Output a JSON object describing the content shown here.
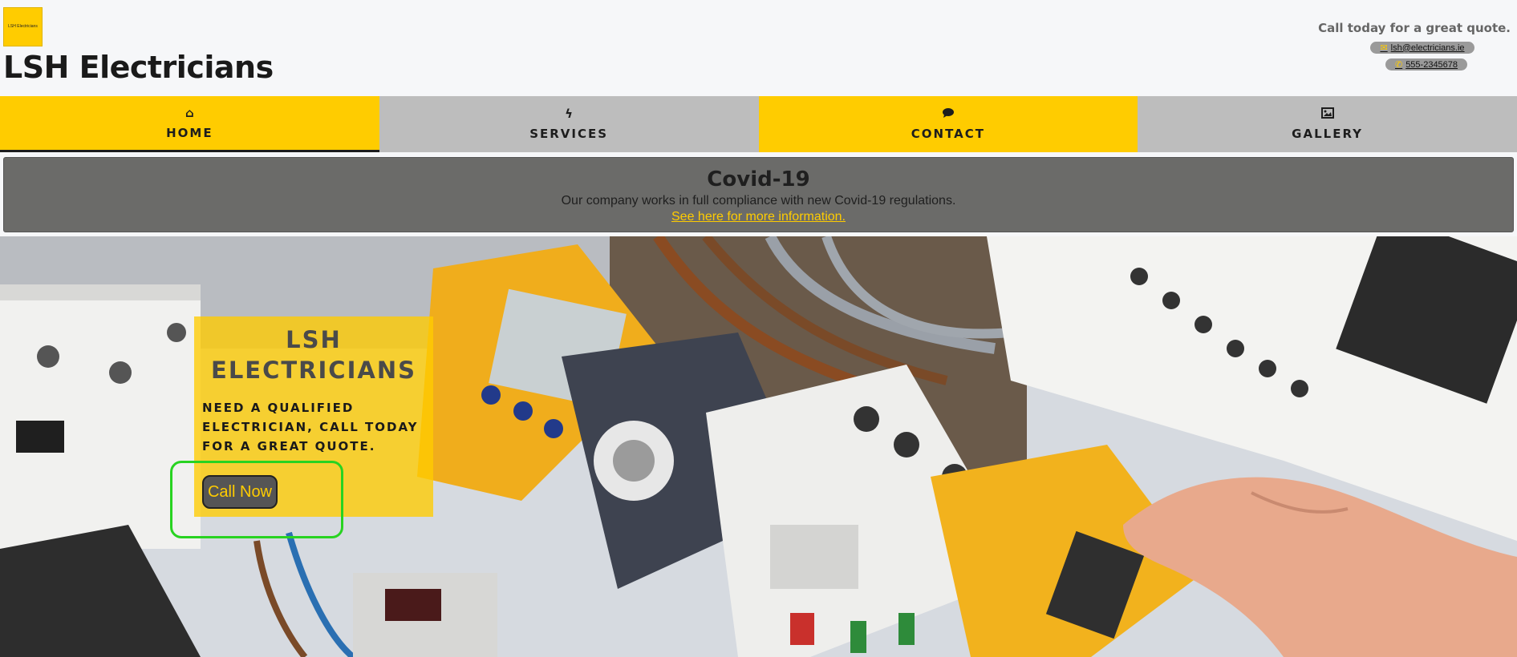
{
  "header": {
    "logo_text": "LSH Electricians",
    "site_title": "LSH Electricians",
    "tagline": "Call today for a great quote.",
    "email": "lsh@electricians.ie",
    "phone": "555-2345678",
    "email_icon": "envelope-icon",
    "phone_icon": "phone-icon"
  },
  "nav": {
    "items": [
      {
        "label": "HOME",
        "icon": "home-icon",
        "active": true
      },
      {
        "label": "SERVICES",
        "icon": "bolt-icon"
      },
      {
        "label": "CONTACT",
        "icon": "comment-icon"
      },
      {
        "label": "GALLERY",
        "icon": "image-icon"
      }
    ]
  },
  "covid": {
    "title": "Covid-19",
    "text": "Our company works in full compliance with new Covid-19 regulations.",
    "link": "See here for more information."
  },
  "hero": {
    "promo_title": "LSH ELECTRICIANS",
    "promo_text": "NEED A QUALIFIED ELECTRICIAN, CALL TODAY FOR A GREAT QUOTE.",
    "button_label": "Call Now",
    "image": "electrical-panel-photo"
  },
  "colors": {
    "brand_yellow": "#ffcc00",
    "nav_gray": "#bdbdbd",
    "banner_gray": "#6b6b69",
    "highlight_green": "#28d321"
  }
}
